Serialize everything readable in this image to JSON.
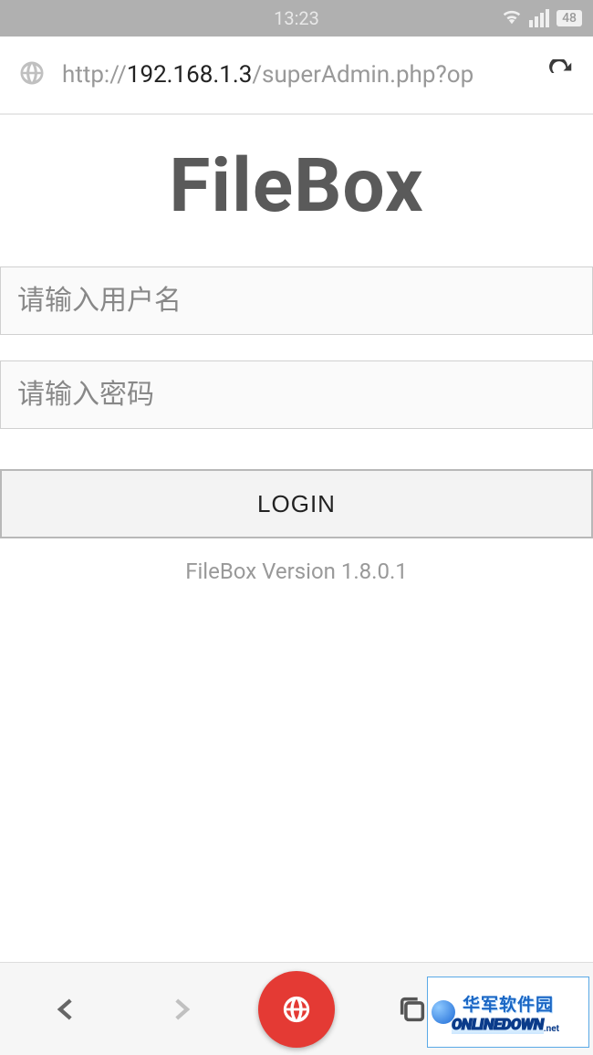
{
  "status_bar": {
    "time": "13:23",
    "battery": "48"
  },
  "address_bar": {
    "url_prefix": "http://",
    "url_host": "192.168.1.3",
    "url_path": "/superAdmin.php?op"
  },
  "page": {
    "title": "FileBox",
    "username_placeholder": "请输入用户名",
    "password_placeholder": "请输入密码",
    "login_label": "LOGIN",
    "version_text": "FileBox Version 1.8.0.1"
  },
  "watermark": {
    "chinese": "华军软件园",
    "english": "ONLINEDOWN",
    "url": ".net"
  }
}
